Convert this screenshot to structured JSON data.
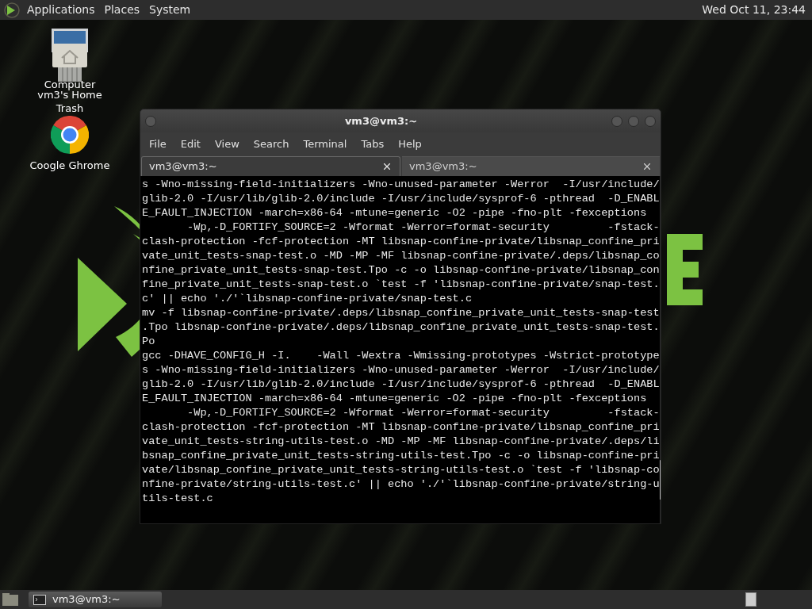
{
  "top_panel": {
    "menus": [
      "Applications",
      "Places",
      "System"
    ],
    "clock": "Wed Oct 11, 23:44"
  },
  "desktop_icons": [
    {
      "kind": "computer",
      "label": "Computer"
    },
    {
      "kind": "home",
      "label": "vm3's Home"
    },
    {
      "kind": "trash",
      "label": "Trash"
    },
    {
      "kind": "browser",
      "label": "Coogle Ghrome"
    }
  ],
  "window": {
    "title": "vm3@vm3:~",
    "menu": [
      "File",
      "Edit",
      "View",
      "Search",
      "Terminal",
      "Tabs",
      "Help"
    ],
    "tabs": [
      {
        "label": "vm3@vm3:~",
        "selected": true
      },
      {
        "label": "vm3@vm3:~",
        "selected": false
      }
    ],
    "lines": [
      "s -Wno-missing-field-initializers -Wno-unused-parameter -Werror  -I/usr/include/",
      "glib-2.0 -I/usr/lib/glib-2.0/include -I/usr/include/sysprof-6 -pthread  -D_ENABL",
      "E_FAULT_INJECTION -march=x86-64 -mtune=generic -O2 -pipe -fno-plt -fexceptions",
      "       -Wp,-D_FORTIFY_SOURCE=2 -Wformat -Werror=format-security         -fstack-",
      "clash-protection -fcf-protection -MT libsnap-confine-private/libsnap_confine_pri",
      "vate_unit_tests-snap-test.o -MD -MP -MF libsnap-confine-private/.deps/libsnap_co",
      "nfine_private_unit_tests-snap-test.Tpo -c -o libsnap-confine-private/libsnap_con",
      "fine_private_unit_tests-snap-test.o `test -f 'libsnap-confine-private/snap-test.",
      "c' || echo './'`libsnap-confine-private/snap-test.c",
      "mv -f libsnap-confine-private/.deps/libsnap_confine_private_unit_tests-snap-test",
      ".Tpo libsnap-confine-private/.deps/libsnap_confine_private_unit_tests-snap-test.",
      "Po",
      "gcc -DHAVE_CONFIG_H -I.    -Wall -Wextra -Wmissing-prototypes -Wstrict-prototype",
      "s -Wno-missing-field-initializers -Wno-unused-parameter -Werror  -I/usr/include/",
      "glib-2.0 -I/usr/lib/glib-2.0/include -I/usr/include/sysprof-6 -pthread  -D_ENABL",
      "E_FAULT_INJECTION -march=x86-64 -mtune=generic -O2 -pipe -fno-plt -fexceptions",
      "       -Wp,-D_FORTIFY_SOURCE=2 -Wformat -Werror=format-security         -fstack-",
      "clash-protection -fcf-protection -MT libsnap-confine-private/libsnap_confine_pri",
      "vate_unit_tests-string-utils-test.o -MD -MP -MF libsnap-confine-private/.deps/li",
      "bsnap_confine_private_unit_tests-string-utils-test.Tpo -c -o libsnap-confine-pri",
      "vate/libsnap_confine_private_unit_tests-string-utils-test.o `test -f 'libsnap-co",
      "nfine-private/string-utils-test.c' || echo './'`libsnap-confine-private/string-u",
      "tils-test.c"
    ]
  },
  "taskbar": {
    "tasks": [
      {
        "label": "vm3@vm3:~",
        "selected": false
      }
    ]
  }
}
